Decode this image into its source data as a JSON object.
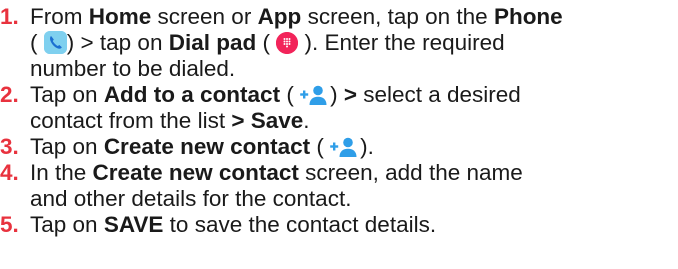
{
  "steps": [
    {
      "number": "1.",
      "parts": {
        "a": "From ",
        "b": "Home",
        "c": " screen or ",
        "d": "App",
        "e": " screen, tap on the ",
        "f": "Phone",
        "g": "(",
        "h": ") > tap on ",
        "i": "Dial pad",
        "j": " (",
        "k": " ). Enter the required",
        "l": "number to be dialed."
      },
      "icons": [
        "phone-icon",
        "dial-pad-icon"
      ]
    },
    {
      "number": "2.",
      "parts": {
        "a": "Tap on ",
        "b": "Add to a contact",
        "c": " (",
        "d": ") ",
        "e": ">",
        "f": " select a desired",
        "g": "contact from the list ",
        "h": "> Save",
        "i": "."
      },
      "icons": [
        "add-contact-icon"
      ]
    },
    {
      "number": "3.",
      "parts": {
        "a": "Tap on ",
        "b": "Create new contact",
        "c": " (",
        "d": ")."
      },
      "icons": [
        "add-contact-icon"
      ]
    },
    {
      "number": "4.",
      "parts": {
        "a": "In the ",
        "b": "Create new contact",
        "c": " screen, add the name",
        "d": "and other details for the contact."
      }
    },
    {
      "number": "5.",
      "parts": {
        "a": "Tap on ",
        "b": "SAVE",
        "c": " to save the contact details."
      }
    }
  ],
  "colors": {
    "step_number": "#e8323e",
    "text": "#1a1a1a",
    "phone_icon_bg": "#7fd0ef",
    "phone_icon_fg": "#1c6fd1",
    "dial_icon_bg": "#f2245a",
    "contact_icon": "#2f9ee8"
  }
}
